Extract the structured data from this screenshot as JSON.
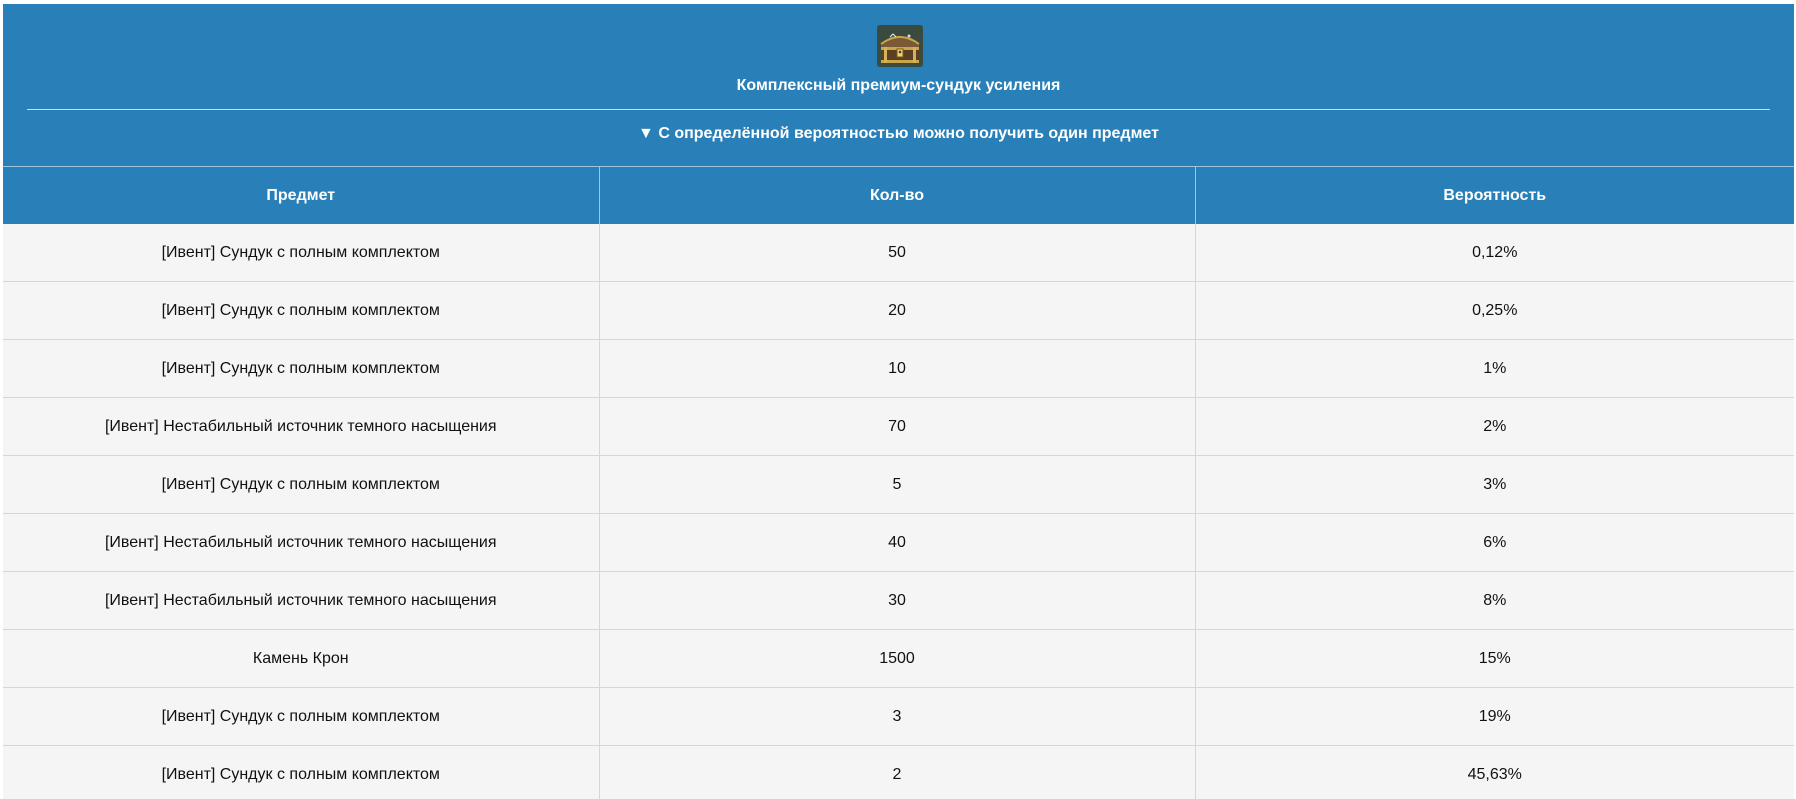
{
  "header": {
    "title": "Комплексный премиум-сундук усиления",
    "subtitle": "▼ С определённой вероятностью можно получить один предмет",
    "icon": "treasure-chest-icon"
  },
  "colors": {
    "accent": "#2980b9",
    "row_background": "#f5f5f5",
    "header_text": "#ffffff"
  },
  "table": {
    "columns": [
      "Предмет",
      "Кол-во",
      "Вероятность"
    ],
    "rows": [
      {
        "item": "[Ивент] Сундук с полным комплектом",
        "qty": "50",
        "prob": "0,12%"
      },
      {
        "item": "[Ивент] Сундук с полным комплектом",
        "qty": "20",
        "prob": "0,25%"
      },
      {
        "item": "[Ивент] Сундук с полным комплектом",
        "qty": "10",
        "prob": "1%"
      },
      {
        "item": "[Ивент] Нестабильный источник темного насыщения",
        "qty": "70",
        "prob": "2%"
      },
      {
        "item": "[Ивент] Сундук с полным комплектом",
        "qty": "5",
        "prob": "3%"
      },
      {
        "item": "[Ивент] Нестабильный источник темного насыщения",
        "qty": "40",
        "prob": "6%"
      },
      {
        "item": "[Ивент] Нестабильный источник темного насыщения",
        "qty": "30",
        "prob": "8%"
      },
      {
        "item": "Камень Крон",
        "qty": "1500",
        "prob": "15%"
      },
      {
        "item": "[Ивент] Сундук с полным комплектом",
        "qty": "3",
        "prob": "19%"
      },
      {
        "item": "[Ивент] Сундук с полным комплектом",
        "qty": "2",
        "prob": "45,63%"
      }
    ]
  }
}
